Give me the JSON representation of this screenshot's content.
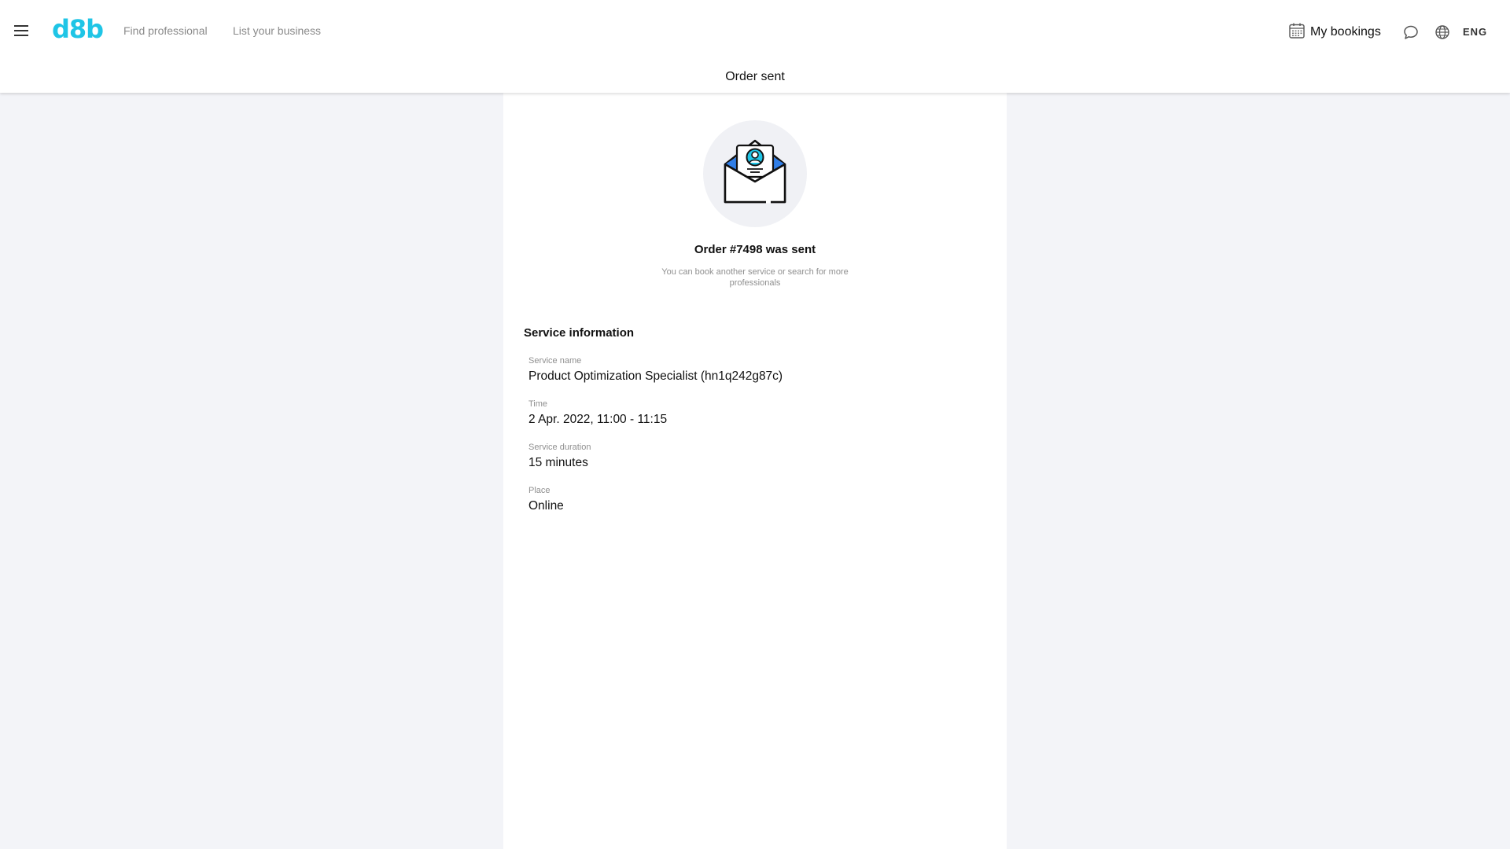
{
  "header": {
    "logo": "d8b",
    "nav": {
      "find_professional": "Find professional",
      "list_business": "List your business"
    },
    "my_bookings": "My bookings",
    "language": "ENG",
    "page_title": "Order sent"
  },
  "confirmation": {
    "title": "Order #7498 was sent",
    "subtitle": "You can book another service or search for more professionals"
  },
  "service_info": {
    "title": "Service information",
    "fields": [
      {
        "label": "Service name",
        "value": "Product Optimization Specialist (hn1q242g87c)"
      },
      {
        "label": "Time",
        "value": "2 Apr. 2022, 11:00 - 11:15"
      },
      {
        "label": "Service duration",
        "value": "15 minutes"
      },
      {
        "label": "Place",
        "value": "Online"
      }
    ]
  },
  "icons": {
    "menu": "menu-icon",
    "calendar": "calendar-icon",
    "chat": "chat-icon",
    "globe": "globe-icon",
    "envelope": "envelope-profile-illustration"
  },
  "colors": {
    "brand": "#1fc5e6",
    "background": "#f3f4f8",
    "card": "#ffffff",
    "muted_text": "#8f8f8f"
  }
}
